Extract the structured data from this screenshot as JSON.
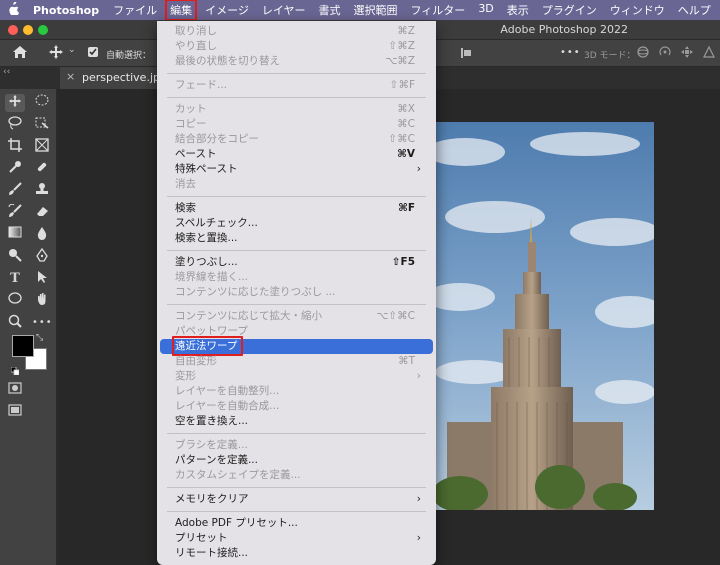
{
  "menubar": {
    "app_name": "Photoshop",
    "items": [
      "ファイル",
      "編集",
      "イメージ",
      "レイヤー",
      "書式",
      "選択範囲",
      "フィルター",
      "3D",
      "表示",
      "プラグイン",
      "ウィンドウ",
      "ヘルプ"
    ],
    "active_index": 1
  },
  "window": {
    "title": "Adobe Photoshop 2022"
  },
  "optionsbar": {
    "auto_select_label": "自動選択：",
    "mode_3d_label": "3D モード：",
    "more_icon": "•••"
  },
  "document": {
    "tab_title": "perspective.jpg",
    "close_glyph": "×"
  },
  "toolbar": {
    "collapse_glyph": "‹‹"
  },
  "edit_menu": {
    "groups": [
      [
        {
          "label": "取り消し",
          "shortcut": "⌘Z",
          "enabled": false
        },
        {
          "label": "やり直し",
          "shortcut": "⇧⌘Z",
          "enabled": false
        },
        {
          "label": "最後の状態を切り替え",
          "shortcut": "⌥⌘Z",
          "enabled": false
        }
      ],
      [
        {
          "label": "フェード...",
          "shortcut": "⇧⌘F",
          "enabled": false
        }
      ],
      [
        {
          "label": "カット",
          "shortcut": "⌘X",
          "enabled": false
        },
        {
          "label": "コピー",
          "shortcut": "⌘C",
          "enabled": false
        },
        {
          "label": "結合部分をコピー",
          "shortcut": "⇧⌘C",
          "enabled": false
        },
        {
          "label": "ペースト",
          "shortcut": "⌘V",
          "enabled": true
        },
        {
          "label": "特殊ペースト",
          "submenu": true,
          "enabled": true
        },
        {
          "label": "消去",
          "enabled": false
        }
      ],
      [
        {
          "label": "検索",
          "shortcut": "⌘F",
          "enabled": true
        },
        {
          "label": "スペルチェック...",
          "enabled": true
        },
        {
          "label": "検索と置換...",
          "enabled": true
        }
      ],
      [
        {
          "label": "塗りつぶし...",
          "shortcut": "⇧F5",
          "enabled": true
        },
        {
          "label": "境界線を描く...",
          "enabled": false
        },
        {
          "label": "コンテンツに応じた塗りつぶし ...",
          "enabled": false
        }
      ],
      [
        {
          "label": "コンテンツに応じて拡大・縮小",
          "shortcut": "⌥⇧⌘C",
          "enabled": false
        },
        {
          "label": "パペットワープ",
          "enabled": false
        },
        {
          "label": "遠近法ワープ",
          "enabled": true,
          "highlighted": true
        },
        {
          "label": "自由変形",
          "shortcut": "⌘T",
          "enabled": false
        },
        {
          "label": "変形",
          "submenu": true,
          "enabled": false
        },
        {
          "label": "レイヤーを自動整列...",
          "enabled": false
        },
        {
          "label": "レイヤーを自動合成...",
          "enabled": false
        },
        {
          "label": "空を置き換え...",
          "enabled": true
        }
      ],
      [
        {
          "label": "ブラシを定義...",
          "enabled": false
        },
        {
          "label": "パターンを定義...",
          "enabled": true
        },
        {
          "label": "カスタムシェイプを定義...",
          "enabled": false
        }
      ],
      [
        {
          "label": "メモリをクリア",
          "submenu": true,
          "enabled": true
        }
      ],
      [
        {
          "label": "Adobe PDF プリセット...",
          "enabled": true
        },
        {
          "label": "プリセット",
          "submenu": true,
          "enabled": true
        },
        {
          "label": "リモート接続...",
          "enabled": true
        }
      ]
    ]
  },
  "colors": {
    "menubar_bg": "#6a6694",
    "highlight": "#3a6fd9",
    "annotation_red": "#e01e1e",
    "traffic_red": "#fe5f57",
    "traffic_yellow": "#febc2e",
    "traffic_green": "#28c840"
  }
}
